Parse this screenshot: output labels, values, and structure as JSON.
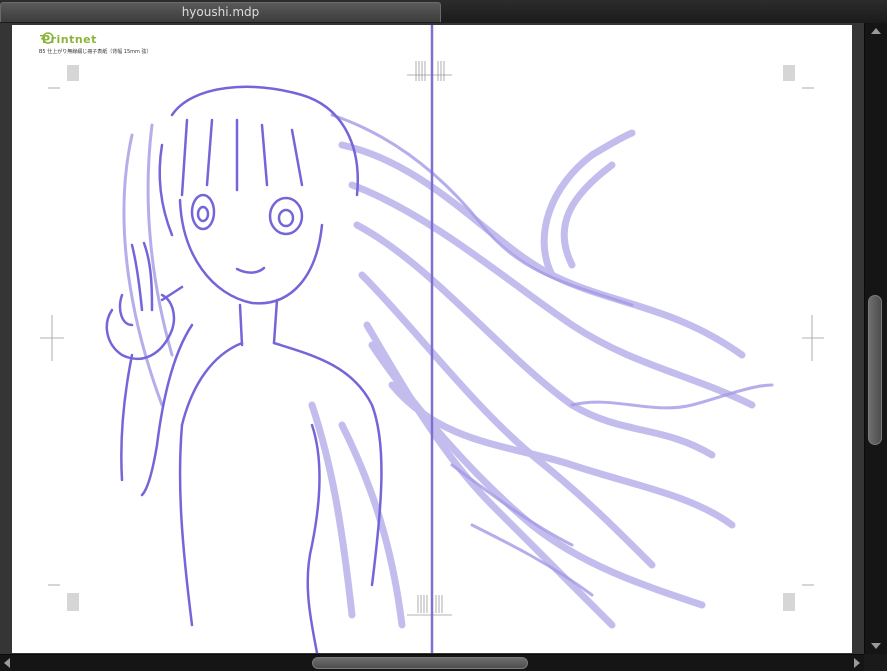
{
  "document": {
    "tab_title": "hyoushi.mdp"
  },
  "canvas": {
    "logo_text": "Printnet",
    "template_label": "B5 仕上がり無線綴じ冊子表紙（背幅 15mm 弦）",
    "background_color": "#ffffff",
    "sketch_color": "#6f60d6",
    "spine_line_color": "#7c70d0",
    "logo_color": "#8bb53a"
  },
  "scrollbars": {
    "vertical_position": 0.57,
    "horizontal_position": 0.48
  }
}
